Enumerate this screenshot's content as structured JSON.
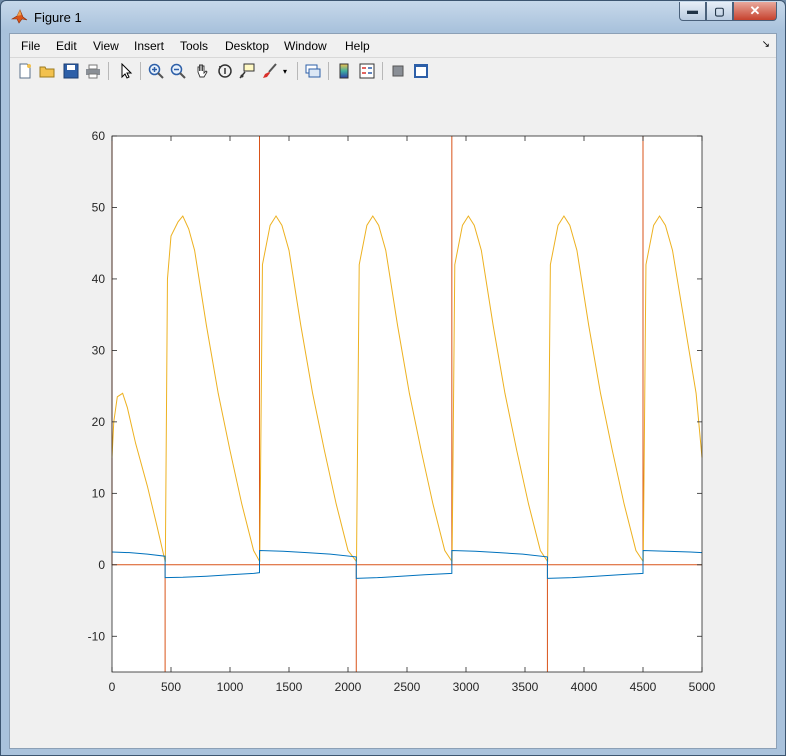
{
  "window": {
    "title": "Figure 1",
    "min_label": "▬",
    "max_label": "▢",
    "close_label": "✕"
  },
  "menu": [
    "File",
    "Edit",
    "View",
    "Insert",
    "Tools",
    "Desktop",
    "Window",
    "Help"
  ],
  "toolbar": {
    "icons": [
      "new-figure-icon",
      "open-file-icon",
      "save-icon",
      "print-icon",
      "edit-plot-arrow-icon",
      "zoom-in-icon",
      "zoom-out-icon",
      "pan-hand-icon",
      "rotate-3d-icon",
      "data-cursor-icon",
      "brush-icon",
      "brush-dropdown-icon",
      "link-plot-icon",
      "colorbar-icon",
      "legend-icon",
      "hide-plot-tools-icon",
      "show-plot-tools-icon"
    ]
  },
  "chart_data": {
    "type": "line",
    "xlim": [
      0,
      5000
    ],
    "ylim": [
      -15,
      60
    ],
    "xticks": [
      0,
      500,
      1000,
      1500,
      2000,
      2500,
      3000,
      3500,
      4000,
      4500,
      5000
    ],
    "yticks": [
      -10,
      0,
      10,
      20,
      30,
      40,
      50,
      60
    ],
    "grid": false,
    "colors": {
      "blue": "#0072bd",
      "orange": "#d95319",
      "yellow": "#edb120"
    },
    "switch_times": [
      0,
      450,
      1250,
      2070,
      2880,
      3690,
      4500,
      5000
    ],
    "series": [
      {
        "color": "#edb120",
        "x": [
          0,
          15,
          45,
          90,
          130,
          200,
          300,
          380,
          450,
          452,
          470,
          500,
          560,
          600,
          650,
          700,
          800,
          900,
          1000,
          1100,
          1200,
          1250,
          1252,
          1275,
          1340,
          1390,
          1440,
          1500,
          1600,
          1700,
          1800,
          1900,
          2000,
          2070,
          2072,
          2095,
          2160,
          2210,
          2260,
          2320,
          2420,
          2520,
          2620,
          2720,
          2820,
          2880,
          2882,
          2905,
          2970,
          3020,
          3070,
          3130,
          3230,
          3330,
          3430,
          3530,
          3630,
          3690,
          3692,
          3715,
          3780,
          3830,
          3880,
          3940,
          4040,
          4140,
          4240,
          4340,
          4440,
          4500,
          4502,
          4525,
          4590,
          4640,
          4690,
          4750,
          4850,
          4950,
          5000
        ],
        "y": [
          15,
          20,
          23.5,
          24,
          22,
          17,
          11,
          5.5,
          0.5,
          0.5,
          40,
          46,
          48,
          48.8,
          47,
          44,
          33.5,
          24,
          16,
          8.5,
          2,
          0.5,
          0.5,
          42,
          47.5,
          48.8,
          47.5,
          44,
          33.5,
          24,
          16,
          8.5,
          2,
          0.5,
          0.5,
          42,
          47.5,
          48.8,
          47.5,
          44,
          33.5,
          24,
          16,
          8.5,
          2,
          0.5,
          0.5,
          42,
          47.5,
          48.8,
          47.5,
          44,
          33.5,
          24,
          16,
          8.5,
          2,
          0.5,
          0.5,
          42,
          47.5,
          48.8,
          47.5,
          44,
          33.5,
          24,
          16,
          8.5,
          2,
          0.5,
          0.5,
          42,
          47.5,
          48.8,
          47.5,
          44,
          34,
          24,
          15
        ]
      },
      {
        "color": "#0072bd",
        "x": [
          0,
          150,
          300,
          450,
          450.1,
          600,
          800,
          1000,
          1200,
          1250,
          1250.1,
          1450,
          1650,
          1850,
          2070,
          2070.1,
          2250,
          2450,
          2650,
          2880,
          2880.1,
          3080,
          3280,
          3480,
          3690,
          3690.1,
          3900,
          4100,
          4300,
          4500,
          4500.1,
          4700,
          4900,
          5000
        ],
        "y": [
          1.8,
          1.7,
          1.5,
          1.2,
          -1.8,
          -1.75,
          -1.6,
          -1.4,
          -1.2,
          -1.1,
          2,
          1.9,
          1.7,
          1.5,
          1.1,
          -1.9,
          -1.8,
          -1.6,
          -1.4,
          -1.2,
          2,
          1.9,
          1.7,
          1.5,
          1.1,
          -1.9,
          -1.8,
          -1.6,
          -1.4,
          -1.2,
          2,
          1.9,
          1.8,
          1.7
        ]
      },
      {
        "color": "#d95319",
        "x": [
          0,
          0,
          0,
          450,
          450,
          450,
          1250,
          1250,
          1250,
          2070,
          2070,
          2070,
          2880,
          2880,
          2880,
          3690,
          3690,
          3690,
          4500,
          4500,
          4500,
          5000
        ],
        "y": [
          60,
          0,
          0,
          0,
          -15,
          0,
          0,
          60,
          0,
          0,
          -15,
          0,
          0,
          60,
          0,
          0,
          -15,
          0,
          0,
          60,
          0,
          0
        ]
      }
    ]
  }
}
